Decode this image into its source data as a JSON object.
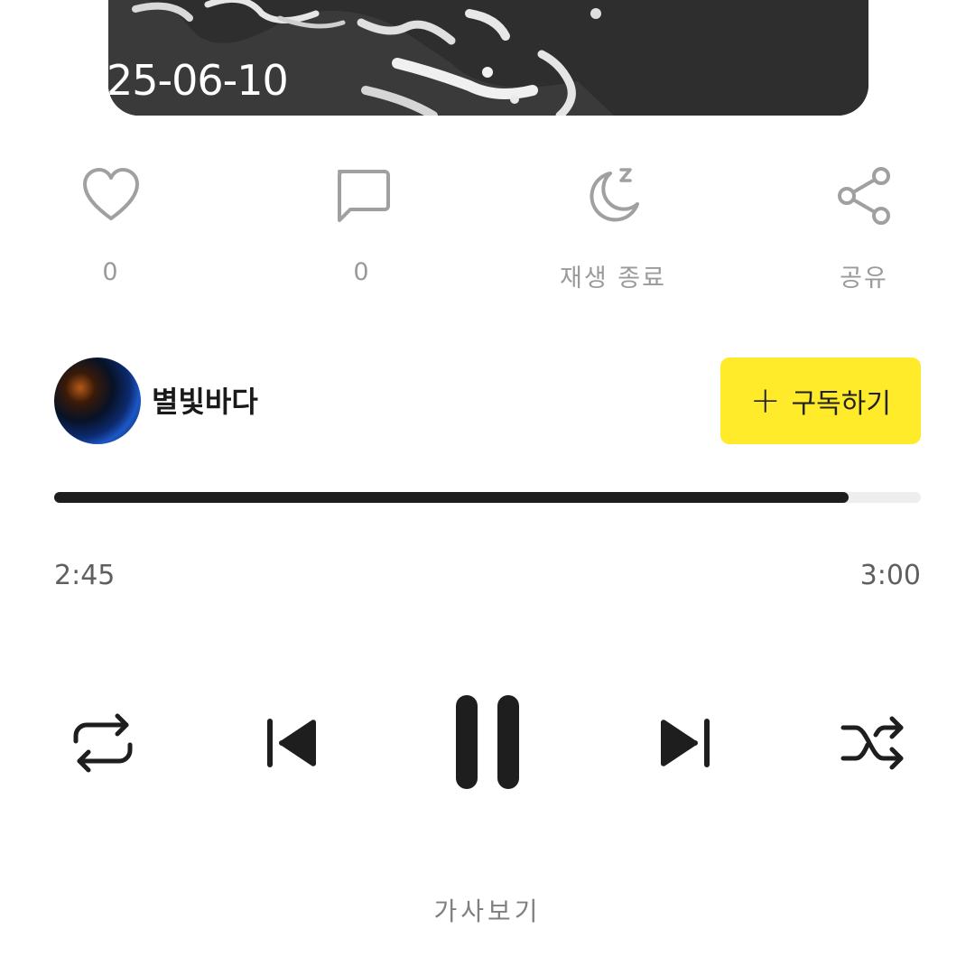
{
  "cover": {
    "date_text": "25-06-10"
  },
  "actions": {
    "like": {
      "icon": "heart-icon",
      "count": "0"
    },
    "comment": {
      "icon": "comment-icon",
      "count": "0"
    },
    "sleep_timer": {
      "icon": "moon-sleep-icon",
      "label": "재생 종료"
    },
    "share": {
      "icon": "share-icon",
      "label": "공유"
    }
  },
  "channel": {
    "name": "별빛바다",
    "subscribe_label": "구독하기",
    "subscribe_color": "#ffeb2a"
  },
  "player": {
    "current_time": "2:45",
    "total_time": "3:00",
    "progress": 0.917
  },
  "controls": {
    "repeat": "repeat-icon",
    "previous": "previous-track-icon",
    "play_pause": "pause-icon",
    "next": "next-track-icon",
    "shuffle": "shuffle-icon"
  },
  "bottom_caption": "가사보기"
}
